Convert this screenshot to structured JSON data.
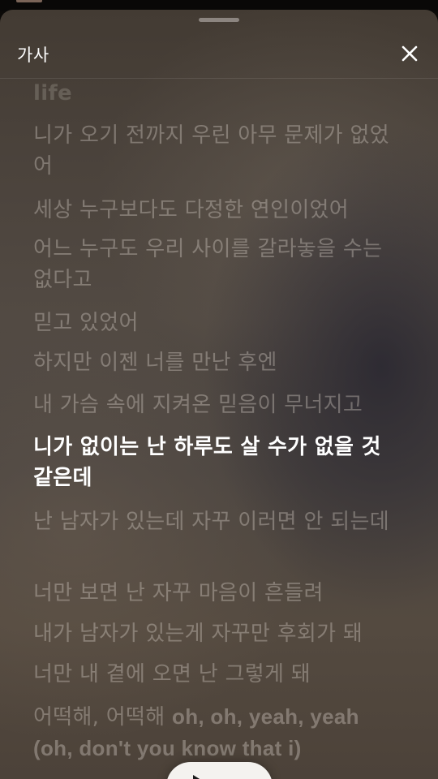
{
  "header": {
    "title": "가사"
  },
  "lyrics": {
    "lines": [
      "life",
      "니가 오기 전까지 우린 아무 문제가 없었어",
      "세상 누구보다도 다정한 연인이었어",
      "어느 누구도 우리 사이를 갈라놓을 수는 없다고",
      "믿고 있었어",
      "하지만 이젠 너를 만난 후엔",
      "내 가슴 속에 지켜온 믿음이 무너지고",
      "니가 없이는 난 하루도 살 수가 없을 것 같은데",
      "난 남자가 있는데 자꾸 이러면 안 되는데",
      "너만 보면 난 자꾸 마음이 흔들려",
      "내가 남자가 있는게 자꾸만 후회가 돼",
      "너만 내 곁에 오면 난 그렇게 돼"
    ],
    "last_line": {
      "part1": "어떡해, 어떡해 ",
      "part2": "oh, oh, yeah, yeah (oh, don't you know that i)"
    },
    "active_index": 7
  },
  "icons": {
    "close": "close-icon",
    "play": "play-icon"
  },
  "colors": {
    "active_text": "#ffffff",
    "inactive_text": "#d7d0c8",
    "sheet_background": "#4a423b",
    "play_pill": "#f4f2ef"
  }
}
